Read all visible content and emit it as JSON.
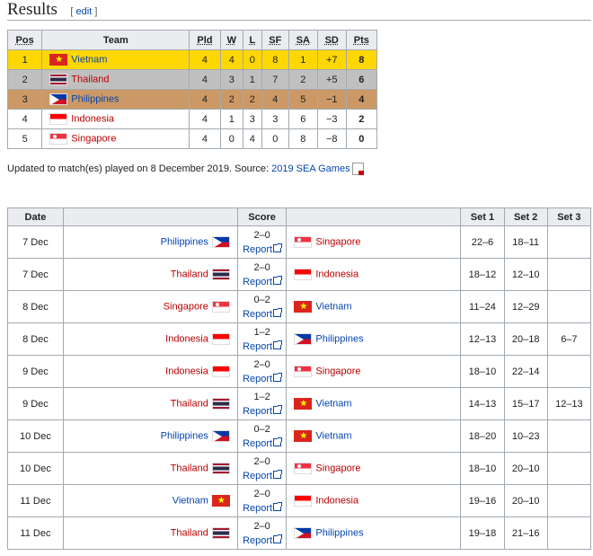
{
  "heading": {
    "title": "Results",
    "edit_open": "[",
    "edit_label": "edit",
    "edit_close": "]"
  },
  "standings": {
    "headers": [
      "Pos",
      "Team",
      "Pld",
      "W",
      "L",
      "SF",
      "SA",
      "SD",
      "Pts"
    ],
    "rows": [
      {
        "pos": "1",
        "team": "Vietnam",
        "flag": "f-vn",
        "pld": "4",
        "w": "4",
        "l": "0",
        "sf": "8",
        "sa": "1",
        "sd": "+7",
        "pts": "8"
      },
      {
        "pos": "2",
        "team": "Thailand",
        "flag": "f-th",
        "pld": "4",
        "w": "3",
        "l": "1",
        "sf": "7",
        "sa": "2",
        "sd": "+5",
        "pts": "6"
      },
      {
        "pos": "3",
        "team": "Philippines",
        "flag": "f-ph",
        "pld": "4",
        "w": "2",
        "l": "2",
        "sf": "4",
        "sa": "5",
        "sd": "−1",
        "pts": "4"
      },
      {
        "pos": "4",
        "team": "Indonesia",
        "flag": "f-id",
        "pld": "4",
        "w": "1",
        "l": "3",
        "sf": "3",
        "sa": "6",
        "sd": "−3",
        "pts": "2"
      },
      {
        "pos": "5",
        "team": "Singapore",
        "flag": "f-sg",
        "pld": "4",
        "w": "0",
        "l": "4",
        "sf": "0",
        "sa": "8",
        "sd": "−8",
        "pts": "0"
      }
    ],
    "row_colors": {
      "gold": "#ffd700",
      "silver": "#c0c0c0",
      "bronze": "#cc9966"
    }
  },
  "note": {
    "text": "Updated to match(es) played on 8 December 2019. Source: ",
    "source_link": "2019 SEA Games"
  },
  "results": {
    "headers": [
      "Date",
      "",
      "Score",
      "",
      "Set 1",
      "Set 2",
      "Set 3"
    ],
    "report_label": "Report",
    "rows": [
      {
        "date": "7 Dec",
        "home": "Philippines",
        "home_flag": "f-ph",
        "score": "2–0",
        "away": "Singapore",
        "away_flag": "f-sg",
        "s1": "22–6",
        "s2": "18–11",
        "s3": ""
      },
      {
        "date": "7 Dec",
        "home": "Thailand",
        "home_flag": "f-th",
        "score": "2–0",
        "away": "Indonesia",
        "away_flag": "f-id",
        "s1": "18–12",
        "s2": "12–10",
        "s3": ""
      },
      {
        "date": "8 Dec",
        "home": "Singapore",
        "home_flag": "f-sg",
        "score": "0–2",
        "away": "Vietnam",
        "away_flag": "f-vn",
        "s1": "11–24",
        "s2": "12–29",
        "s3": ""
      },
      {
        "date": "8 Dec",
        "home": "Indonesia",
        "home_flag": "f-id",
        "score": "1–2",
        "away": "Philippines",
        "away_flag": "f-ph",
        "s1": "12–13",
        "s2": "20–18",
        "s3": "6–7"
      },
      {
        "date": "9 Dec",
        "home": "Indonesia",
        "home_flag": "f-id",
        "score": "2–0",
        "away": "Singapore",
        "away_flag": "f-sg",
        "s1": "18–10",
        "s2": "22–14",
        "s3": ""
      },
      {
        "date": "9 Dec",
        "home": "Thailand",
        "home_flag": "f-th",
        "score": "1–2",
        "away": "Vietnam",
        "away_flag": "f-vn",
        "s1": "14–13",
        "s2": "15–17",
        "s3": "12–13"
      },
      {
        "date": "10 Dec",
        "home": "Philippines",
        "home_flag": "f-ph",
        "score": "0–2",
        "away": "Vietnam",
        "away_flag": "f-vn",
        "s1": "18–20",
        "s2": "10–23",
        "s3": ""
      },
      {
        "date": "10 Dec",
        "home": "Thailand",
        "home_flag": "f-th",
        "score": "2–0",
        "away": "Singapore",
        "away_flag": "f-sg",
        "s1": "18–10",
        "s2": "20–10",
        "s3": ""
      },
      {
        "date": "11 Dec",
        "home": "Vietnam",
        "home_flag": "f-vn",
        "score": "2–0",
        "away": "Indonesia",
        "away_flag": "f-id",
        "s1": "19–16",
        "s2": "20–10",
        "s3": ""
      },
      {
        "date": "11 Dec",
        "home": "Thailand",
        "home_flag": "f-th",
        "score": "2–0",
        "away": "Philippines",
        "away_flag": "f-ph",
        "s1": "19–18",
        "s2": "21–16",
        "s3": ""
      }
    ]
  }
}
